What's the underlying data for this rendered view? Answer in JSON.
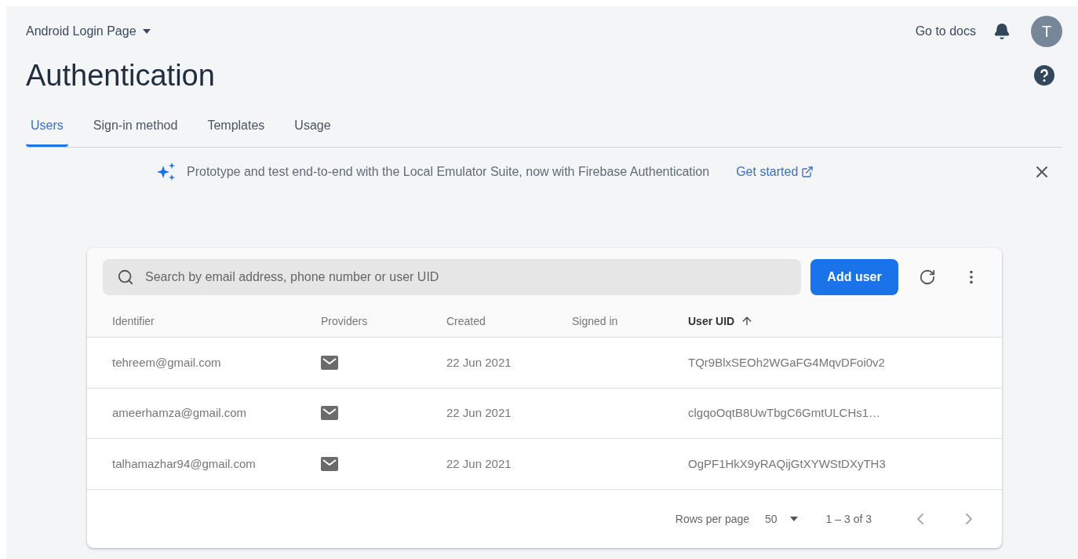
{
  "header": {
    "project": "Android Login Page",
    "docs_link": "Go to docs",
    "avatar_letter": "T"
  },
  "title": "Authentication",
  "tabs": [
    {
      "label": "Users",
      "selected": true
    },
    {
      "label": "Sign-in method",
      "selected": false
    },
    {
      "label": "Templates",
      "selected": false
    },
    {
      "label": "Usage",
      "selected": false
    }
  ],
  "banner": {
    "text": "Prototype and test end-to-end with the Local Emulator Suite, now with Firebase Authentication",
    "link": "Get started"
  },
  "search": {
    "placeholder": "Search by email address, phone number or user UID"
  },
  "add_button": "Add user",
  "table": {
    "columns": [
      {
        "label": "Identifier",
        "sorted": false
      },
      {
        "label": "Providers",
        "sorted": false
      },
      {
        "label": "Created",
        "sorted": false
      },
      {
        "label": "Signed in",
        "sorted": false
      },
      {
        "label": "User UID",
        "sorted": true
      }
    ],
    "rows": [
      {
        "identifier": "tehreem@gmail.com",
        "created": "22 Jun 2021",
        "uid": "TQr9BlxSEOh2WGaFG4MqvDFoi0v2"
      },
      {
        "identifier": "ameerhamza@gmail.com",
        "created": "22 Jun 2021",
        "uid": "clgqoOqtB8UwTbgC6GmtULCHs1…"
      },
      {
        "identifier": "talhamazhar94@gmail.com",
        "created": "22 Jun 2021",
        "uid": "OgPF1HkX9yRAQijGtXYWStDXyTH3"
      }
    ]
  },
  "pagination": {
    "rows_label": "Rows per page",
    "rows_value": "50",
    "range": "1 – 3 of 3"
  }
}
